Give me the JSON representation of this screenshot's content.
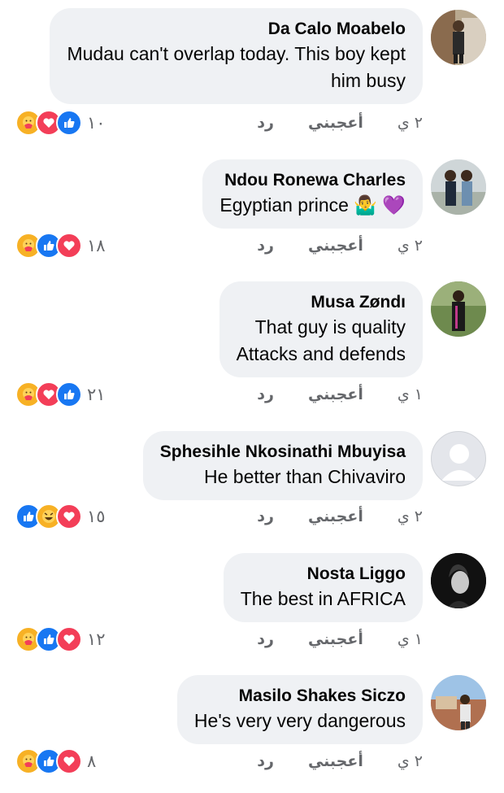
{
  "comments": [
    {
      "name": "Da Calo Moabelo",
      "lines": [
        "Mudau can't overlap today. This boy kept",
        "him busy"
      ],
      "count": "١٠",
      "time": "٢ ي",
      "like": "أعجبني",
      "reply": "رد",
      "reactions": [
        "care",
        "love",
        "like"
      ]
    },
    {
      "name": "Ndou Ronewa Charles",
      "lines": [
        "Egyptian prince 🤷‍♂️ 💜"
      ],
      "count": "١٨",
      "time": "٢ ي",
      "like": "أعجبني",
      "reply": "رد",
      "reactions": [
        "care",
        "like",
        "love"
      ]
    },
    {
      "name": "Musa Zøndı",
      "lines": [
        "That guy is quality",
        "Attacks and defends"
      ],
      "count": "٢١",
      "time": "١ ي",
      "like": "أعجبني",
      "reply": "رد",
      "reactions": [
        "care",
        "love",
        "like"
      ]
    },
    {
      "name": "Sphesihle Nkosinathi Mbuyisa",
      "lines": [
        "He better than Chivaviro"
      ],
      "count": "١٥",
      "time": "٢ ي",
      "like": "أعجبني",
      "reply": "رد",
      "reactions": [
        "like",
        "haha",
        "love"
      ]
    },
    {
      "name": "Nosta Liggo",
      "lines": [
        "The best in AFRICA"
      ],
      "count": "١٢",
      "time": "١ ي",
      "like": "أعجبني",
      "reply": "رد",
      "reactions": [
        "care",
        "like",
        "love"
      ]
    },
    {
      "name": "Masilo Shakes Siczo",
      "lines": [
        "He's very very dangerous"
      ],
      "count": "٨",
      "time": "٢ ي",
      "like": "أعجبني",
      "reply": "رد",
      "reactions": [
        "care",
        "like",
        "love"
      ]
    }
  ],
  "colors": {
    "like": "#1877f2",
    "love": "#f33e58",
    "care": "#f7b125",
    "bubble": "#eff1f4"
  }
}
